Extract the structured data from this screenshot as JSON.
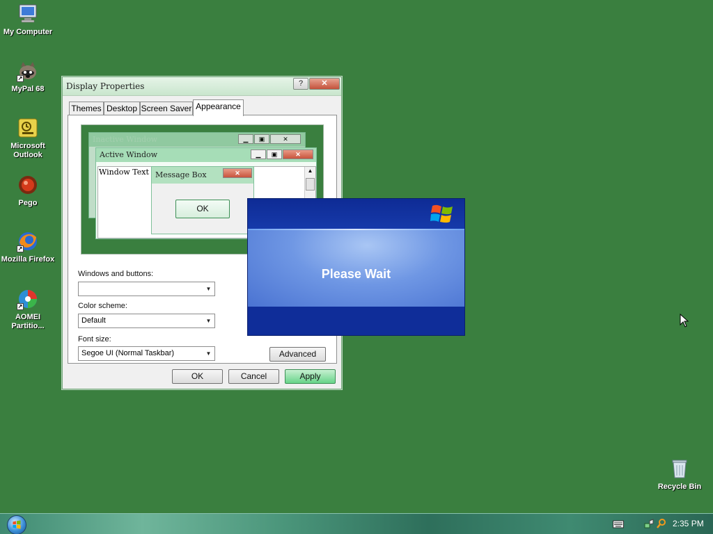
{
  "desktop": {
    "icons": [
      {
        "label": "My Computer"
      },
      {
        "label": "MyPal 68"
      },
      {
        "label": "Microsoft Outlook"
      },
      {
        "label": "Pego"
      },
      {
        "label": "Mozilla Firefox"
      },
      {
        "label": "AOMEI Partitio..."
      },
      {
        "label": "Recycle Bin"
      }
    ]
  },
  "display_properties": {
    "title": "Display Properties",
    "help_label": "?",
    "close_label": "✕",
    "tabs": [
      "Themes",
      "Desktop",
      "Screen Saver",
      "Appearance"
    ],
    "active_tab": "Appearance",
    "preview": {
      "inactive_title": "Inactive Window",
      "active_title": "Active Window",
      "window_text": "Window Text",
      "message_box_title": "Message Box",
      "ok_label": "OK"
    },
    "windows_buttons_label": "Windows and buttons:",
    "windows_buttons_value": "",
    "color_scheme_label": "Color scheme:",
    "color_scheme_value": "Default",
    "font_size_label": "Font size:",
    "font_size_value": "Segoe UI (Normal Taskbar)",
    "advanced_label": "Advanced",
    "ok_label": "OK",
    "cancel_label": "Cancel",
    "apply_label": "Apply"
  },
  "please_wait": {
    "text": "Please Wait"
  },
  "taskbar": {
    "clock": "2:35 PM"
  },
  "colors": {
    "desktop": "#3a7f3f",
    "accent_green": "#67d489",
    "wait_blue": "#0f2d99"
  }
}
